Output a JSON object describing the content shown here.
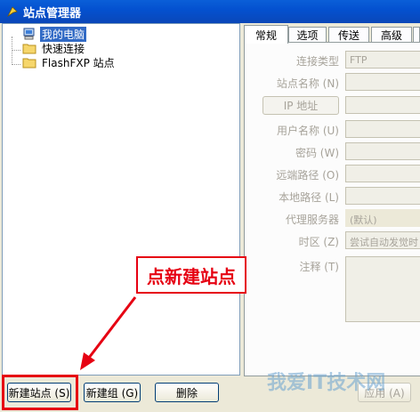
{
  "window": {
    "title": "站点管理器"
  },
  "tree": {
    "items": [
      {
        "label": "我的电脑",
        "icon": "computer-icon",
        "selected": true
      },
      {
        "label": "快速连接",
        "icon": "folder-icon",
        "selected": false
      },
      {
        "label": "FlashFXP 站点",
        "icon": "folder-icon",
        "selected": false
      }
    ]
  },
  "tabs": [
    {
      "label": "常规",
      "active": true
    },
    {
      "label": "选项",
      "active": false
    },
    {
      "label": "传送",
      "active": false
    },
    {
      "label": "高级",
      "active": false
    }
  ],
  "form": {
    "connection_type_label": "连接类型",
    "connection_type_value": "FTP",
    "site_name_label": "站点名称 (N)",
    "ip_button_label": "IP 地址",
    "username_label": "用户名称 (U)",
    "password_label": "密码 (W)",
    "remote_path_label": "远端路径 (O)",
    "local_path_label": "本地路径 (L)",
    "proxy_label": "代理服务器",
    "proxy_value": "(默认)",
    "timezone_label": "时区 (Z)",
    "timezone_value": "尝试自动发觉时",
    "notes_label": "注释 (T)"
  },
  "buttons": {
    "new_site": "新建站点 (S)",
    "new_group": "新建组 (G)",
    "delete": "删除",
    "apply": "应用 (A)"
  },
  "annotation": {
    "callout_text": "点新建站点",
    "accent_color": "#e60012"
  },
  "watermark": {
    "text": "我爱IT技术网"
  }
}
